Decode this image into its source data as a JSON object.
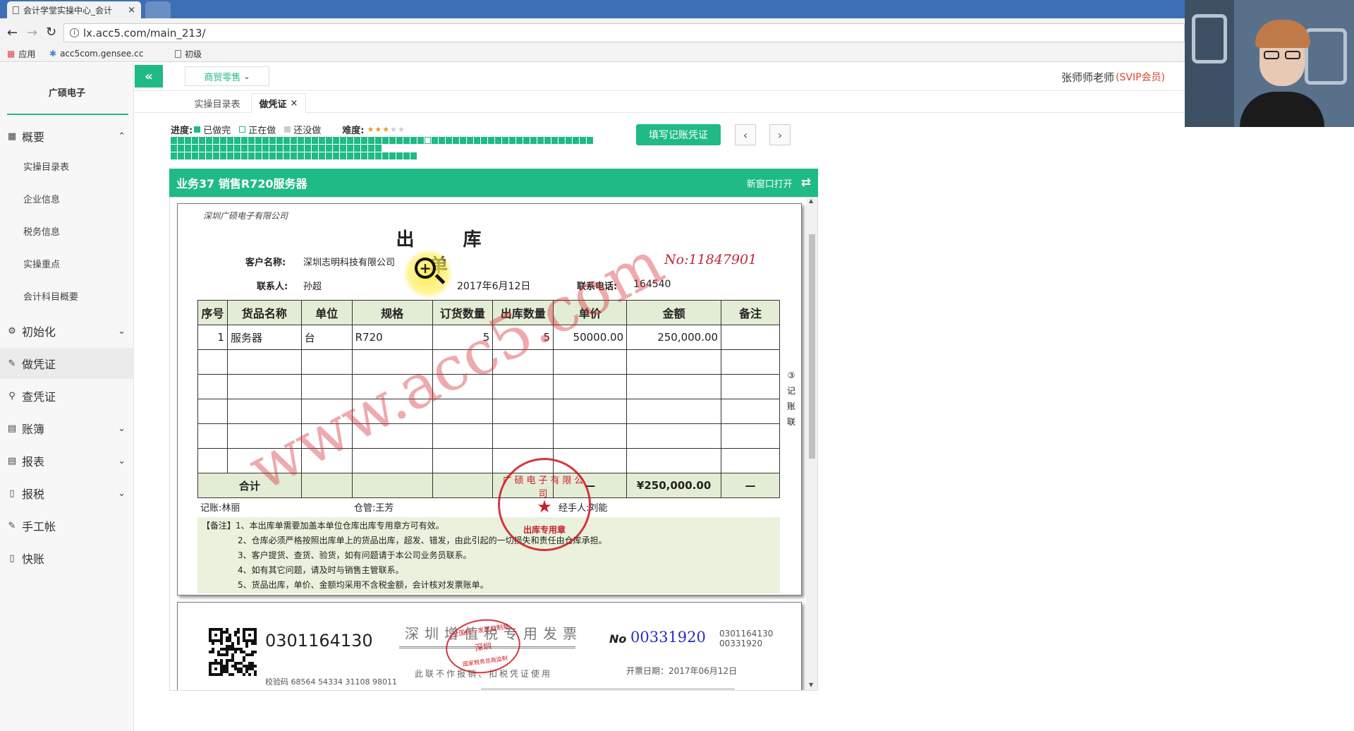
{
  "browser": {
    "tab_title": "会计学堂实操中心_会计",
    "url": "lx.acc5.com/main_213/",
    "bookmarks": [
      "应用",
      "acc5com.gensee.cc",
      "初级"
    ]
  },
  "app": {
    "company": "广硕电子",
    "category": "商贸零售",
    "user": "张师师老师",
    "membership": "(SVIP会员)"
  },
  "sidebar": {
    "sections": [
      {
        "label": "概要",
        "icon": "dashboard-icon",
        "expanded": true,
        "items": [
          "实操目录表",
          "企业信息",
          "税务信息",
          "实操重点",
          "会计科目概要"
        ]
      },
      {
        "label": "初始化",
        "icon": "gear-icon"
      },
      {
        "label": "做凭证",
        "icon": "pencil-icon",
        "active": true
      },
      {
        "label": "查凭证",
        "icon": "search-icon"
      },
      {
        "label": "账簿",
        "icon": "book-icon"
      },
      {
        "label": "报表",
        "icon": "report-icon"
      },
      {
        "label": "报税",
        "icon": "file-icon"
      },
      {
        "label": "手工帐",
        "icon": "pen-icon"
      },
      {
        "label": "快账",
        "icon": "file-icon"
      }
    ]
  },
  "tabs": [
    "实操目录表",
    "做凭证"
  ],
  "progress": {
    "label": "进度:",
    "done": "已做完",
    "doing": "正在做",
    "todo": "还没做",
    "difficulty_label": "难度:",
    "difficulty": 3,
    "difficulty_max": 5,
    "grid_total": 90,
    "grid_current": 37
  },
  "actions": {
    "fill_voucher": "填写记账凭证"
  },
  "panel": {
    "title": "业务37 销售R720服务器",
    "new_window": "新窗口打开"
  },
  "delivery_note": {
    "company": "深圳广硕电子有限公司",
    "title": "出 库 单",
    "no": "No:11847901",
    "customer_label": "客户名称:",
    "customer": "深圳志明科技有限公司",
    "contact_label": "联系人:",
    "contact": "孙超",
    "date": "2017年6月12日",
    "phone_label": "联系电话:",
    "phone": "164540",
    "headers": [
      "序号",
      "货品名称",
      "单位",
      "规格",
      "订货数量",
      "出库数量",
      "单价",
      "金额",
      "备注"
    ],
    "rows": [
      [
        "1",
        "服务器",
        "台",
        "R720",
        "5",
        "5",
        "50000.00",
        "250,000.00",
        ""
      ]
    ],
    "total_label": "合计",
    "total_dash": "—",
    "total_amount": "¥250,000.00",
    "total_remark": "—",
    "side_label": "③记账联",
    "bookkeeper": "记账:林丽",
    "warehouse": "仓管:王芳",
    "handler": "经手人:刘能",
    "stamp_text": "广硕电子有限公司",
    "stamp_bottom": "出库专用章",
    "notes": [
      "【备注】1、本出库单需要加盖本单位仓库出库专用章方可有效。",
      "2、仓库必须严格按照出库单上的货品出库，超发、错发，由此引起的一切损失和责任由仓库承担。",
      "3、客户提货、查货、验货，如有问题请于本公司业务员联系。",
      "4、如有其它问题，请及时与销售主管联系。",
      "5、货品出库，单价、金额均采用不含税金额，会计核对发票账单。"
    ],
    "watermark": "www.acc5.com"
  },
  "invoice": {
    "code": "0301164130",
    "title": "深圳增值税专用发票",
    "no_label": "No",
    "no": "00331920",
    "code_small": "0301164130",
    "no_small": "00331920",
    "check_code": "校验码 68564 54334 31108 98011",
    "subtitle": "此联不作报销、扣税凭证使用",
    "date": "开票日期：2017年06月12日",
    "stamp_text": "全国统一发票监制章",
    "stamp_mid": "深圳",
    "stamp_bottom": "国家税务总局监制"
  }
}
